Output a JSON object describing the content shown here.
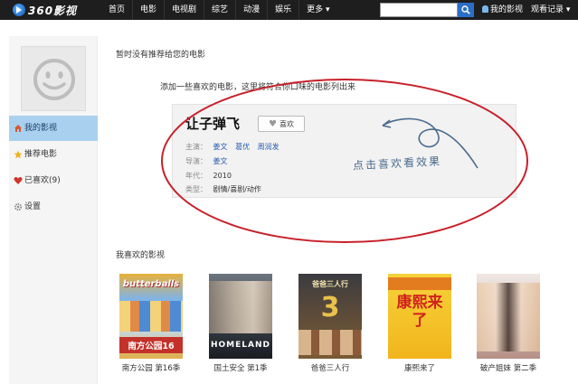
{
  "topbar": {
    "logo_text": "360影视",
    "nav": [
      "首页",
      "电影",
      "电视剧",
      "综艺",
      "动漫",
      "娱乐",
      "更多 ▾"
    ],
    "search_value": "",
    "my_videos": "我的影视",
    "watch_history": "观看记录 ▾"
  },
  "sidebar": {
    "items": [
      {
        "label": "我的影视",
        "icon": "home-icon",
        "active": true
      },
      {
        "label": "推荐电影",
        "icon": "star-icon",
        "active": false
      },
      {
        "label": "已喜欢(9)",
        "icon": "heart-icon",
        "active": false
      },
      {
        "label": "设置",
        "icon": "gear-icon",
        "active": false
      }
    ]
  },
  "main": {
    "recommend_title": "暂时没有推荐给您的电影",
    "hint": "添加一些喜欢的电影，这里将符合你口味的电影列出来",
    "card": {
      "title": "让子弹飞",
      "like_label": "喜欢",
      "cast_label": "主演：",
      "cast": [
        "姜文",
        "葛优",
        "周润发"
      ],
      "director_label": "导演：",
      "director": "姜文",
      "year_label": "年代：",
      "year": "2010",
      "genre_label": "类型：",
      "genre": "剧情/喜剧/动作"
    },
    "handnote": "点击喜欢看效果",
    "liked_title": "我喜欢的影视",
    "movies": [
      {
        "caption": "南方公园 第16季",
        "poster_text": "南方公园16",
        "top_text": "butterballs"
      },
      {
        "caption": "国土安全 第1季",
        "poster_text": "HOMELAND",
        "top_text": ""
      },
      {
        "caption": "爸爸三人行",
        "poster_text": "3",
        "top_text": "爸爸三人行"
      },
      {
        "caption": "康熙来了",
        "poster_text": "康熙来了",
        "top_text": ""
      },
      {
        "caption": "破产姐妹 第二季",
        "poster_text": "",
        "top_text": ""
      }
    ]
  },
  "colors": {
    "topbar_bg": "#1e1e1e",
    "sidebar_active": "#a9d1ef",
    "link_blue": "#2a5db0",
    "ellipse_red": "#c8202a",
    "search_btn": "#2a6fc7"
  }
}
